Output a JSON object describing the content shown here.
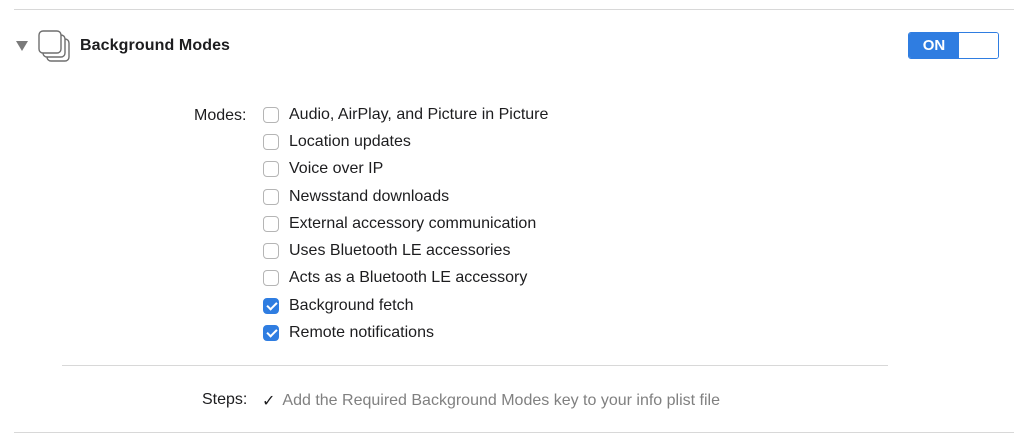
{
  "section": {
    "title": "Background Modes",
    "icon": "background-modes-icon",
    "toggle_label": "ON",
    "toggle_state": "on",
    "accent_color": "#2f7de1"
  },
  "modes": {
    "label": "Modes:",
    "items": [
      {
        "label": "Audio, AirPlay, and Picture in Picture",
        "checked": false
      },
      {
        "label": "Location updates",
        "checked": false
      },
      {
        "label": "Voice over IP",
        "checked": false
      },
      {
        "label": "Newsstand downloads",
        "checked": false
      },
      {
        "label": "External accessory communication",
        "checked": false
      },
      {
        "label": "Uses Bluetooth LE accessories",
        "checked": false
      },
      {
        "label": "Acts as a Bluetooth LE accessory",
        "checked": false
      },
      {
        "label": "Background fetch",
        "checked": true
      },
      {
        "label": "Remote notifications",
        "checked": true
      }
    ]
  },
  "steps": {
    "label": "Steps:",
    "check_glyph": "✓",
    "items": [
      {
        "text": "Add the Required Background Modes key to your info plist file",
        "done": true
      }
    ]
  }
}
